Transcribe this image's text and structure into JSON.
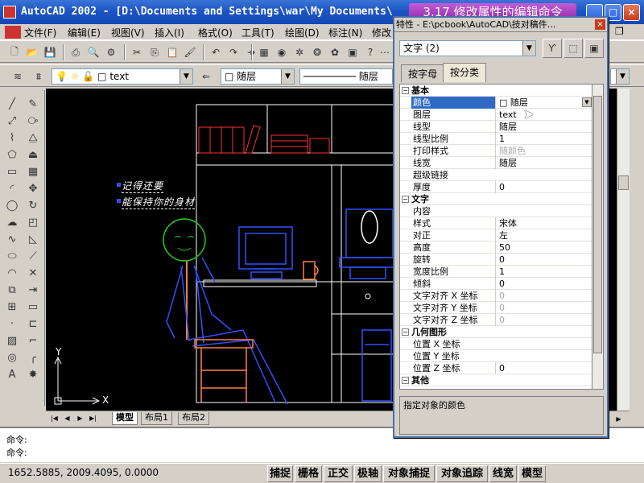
{
  "window": {
    "title": "AutoCAD 2002 - [D:\\Documents and Settings\\war\\My Documents\\",
    "banner": "3.17 修改属性的编辑命令"
  },
  "menu": [
    "文件(F)",
    "编辑(E)",
    "视图(V)",
    "插入(I)",
    "格式(O)",
    "工具(T)",
    "绘图(D)",
    "标注(N)",
    "修改"
  ],
  "toolbar": {
    "layer_name": "text",
    "color_value": "随层",
    "linetype_value": "随层"
  },
  "drawing": {
    "note_line1": "记得还要",
    "note_line2": "能保持你的身材",
    "axis_y": "Y",
    "axis_x": "X"
  },
  "layout_tabs": [
    "模型",
    "布局1",
    "布局2"
  ],
  "command": {
    "line1": "命令:",
    "line2": "命令:"
  },
  "status": {
    "coords": "1652.5885, 2009.4095, 0.0000",
    "buttons": [
      "捕捉",
      "栅格",
      "正交",
      "极轴",
      "对象捕捉",
      "对象追踪",
      "线宽",
      "模型"
    ]
  },
  "properties": {
    "title": "特性 - E:\\pcbook\\AutoCAD\\技对稿件...",
    "selection": "文字 (2)",
    "tabs": [
      "按字母",
      "按分类"
    ],
    "active_tab": 1,
    "rows": [
      {
        "kind": "cat",
        "name": "基本",
        "toggle": "−"
      },
      {
        "kind": "prop",
        "name": "颜色",
        "value": "随层",
        "selected": true
      },
      {
        "kind": "prop",
        "name": "图层",
        "value": "text"
      },
      {
        "kind": "prop",
        "name": "线型",
        "value": "随层"
      },
      {
        "kind": "prop",
        "name": "线型比例",
        "value": "1"
      },
      {
        "kind": "prop",
        "name": "打印样式",
        "value": "随颜色",
        "dim": true
      },
      {
        "kind": "prop",
        "name": "线宽",
        "value": "随层"
      },
      {
        "kind": "prop",
        "name": "超级链接",
        "value": ""
      },
      {
        "kind": "prop",
        "name": "厚度",
        "value": "0"
      },
      {
        "kind": "cat",
        "name": "文字",
        "toggle": "−"
      },
      {
        "kind": "prop",
        "name": "内容",
        "value": ""
      },
      {
        "kind": "prop",
        "name": "样式",
        "value": "宋体"
      },
      {
        "kind": "prop",
        "name": "对正",
        "value": "左"
      },
      {
        "kind": "prop",
        "name": "高度",
        "value": "50"
      },
      {
        "kind": "prop",
        "name": "旋转",
        "value": "0"
      },
      {
        "kind": "prop",
        "name": "宽度比例",
        "value": "1"
      },
      {
        "kind": "prop",
        "name": "倾斜",
        "value": "0"
      },
      {
        "kind": "prop",
        "name": "文字对齐 X 坐标",
        "value": "0",
        "dim": true
      },
      {
        "kind": "prop",
        "name": "文字对齐 Y 坐标",
        "value": "0",
        "dim": true
      },
      {
        "kind": "prop",
        "name": "文字对齐 Z 坐标",
        "value": "0",
        "dim": true
      },
      {
        "kind": "cat",
        "name": "几何图形",
        "toggle": "−"
      },
      {
        "kind": "prop",
        "name": "位置 X 坐标",
        "value": ""
      },
      {
        "kind": "prop",
        "name": "位置 Y 坐标",
        "value": ""
      },
      {
        "kind": "prop",
        "name": "位置 Z 坐标",
        "value": "0"
      },
      {
        "kind": "cat",
        "name": "其他",
        "toggle": "−"
      }
    ],
    "description": "指定对象的颜色"
  },
  "colors": {
    "canvas_bg": "#000000",
    "title_blue": "#1d55c4",
    "selection_blue": "#316ac5"
  }
}
